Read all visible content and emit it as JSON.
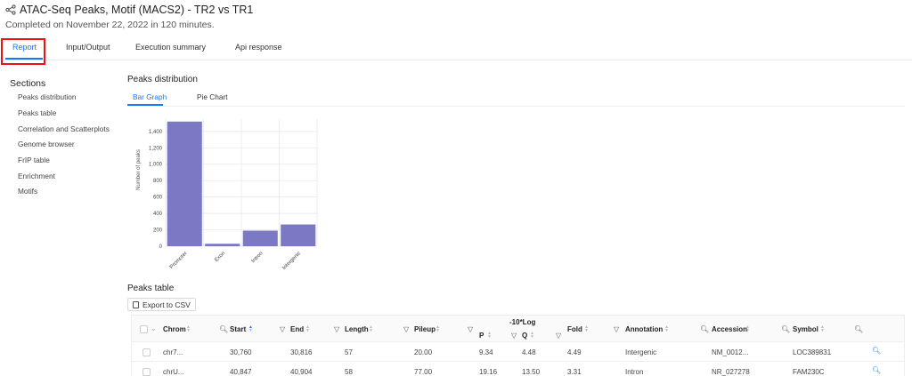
{
  "header": {
    "title": "ATAC-Seq Peaks, Motif (MACS2) - TR2 vs TR1",
    "subtitle": "Completed on November 22, 2022 in 120 minutes.",
    "share_icon": "share-icon"
  },
  "tabs": [
    {
      "label": "Report",
      "active": true
    },
    {
      "label": "Input/Output",
      "active": false
    },
    {
      "label": "Execution summary",
      "active": false
    },
    {
      "label": "Api response",
      "active": false
    }
  ],
  "sidebar": {
    "title": "Sections",
    "items": [
      {
        "label": "Peaks distribution"
      },
      {
        "label": "Peaks table"
      },
      {
        "label": "Correlation and Scatterplots"
      },
      {
        "label": "Genome browser"
      },
      {
        "label": "FrIP table"
      },
      {
        "label": "Enrichment"
      },
      {
        "label": "Motifs"
      }
    ]
  },
  "peaks_distribution": {
    "title": "Peaks distribution",
    "subtabs": [
      {
        "label": "Bar Graph",
        "active": true
      },
      {
        "label": "Pie Chart",
        "active": false
      }
    ]
  },
  "chart_data": {
    "type": "bar",
    "categories": [
      "Promoter",
      "Exon",
      "Intron",
      "Intergenic"
    ],
    "values": [
      1520,
      30,
      190,
      265
    ],
    "ylabel": "Number of peaks",
    "ylim": [
      0,
      1550
    ],
    "yticks": [
      0,
      200,
      400,
      600,
      800,
      "1,000",
      "1,200",
      "1,400"
    ],
    "ytick_values": [
      0,
      200,
      400,
      600,
      800,
      1000,
      1200,
      1400
    ],
    "bar_color": "#7b79c4",
    "grid": true
  },
  "peaks_table": {
    "title": "Peaks table",
    "export_label": "Export to CSV",
    "group_header": "-10*Log",
    "columns": [
      "Chrom",
      "Start",
      "End",
      "Length",
      "Pileup",
      "P",
      "Q",
      "Fold",
      "Annotation",
      "Accession",
      "Symbol"
    ],
    "rows": [
      [
        "chr7...",
        "30,760",
        "30,816",
        "57",
        "20.00",
        "9.34",
        "4.48",
        "4.49",
        "Intergenic",
        "NM_0012...",
        "LOC389831"
      ],
      [
        "chrU...",
        "40,847",
        "40,904",
        "58",
        "77.00",
        "19.16",
        "13.50",
        "3.31",
        "Intron",
        "NR_027278",
        "FAM230C"
      ]
    ]
  },
  "colors": {
    "accent": "#1677ff",
    "highlight_box": "#e11111"
  }
}
